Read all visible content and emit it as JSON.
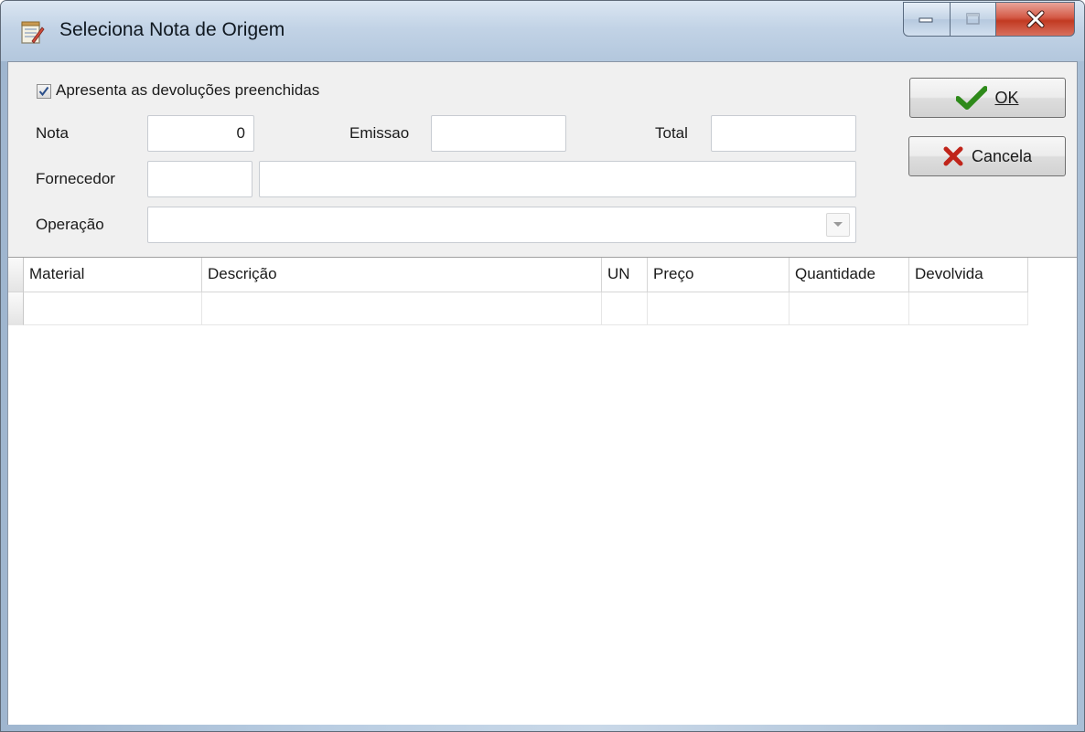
{
  "window": {
    "title": "Seleciona Nota de Origem"
  },
  "options": {
    "show_returns_label": "Apresenta as devoluções preenchidas",
    "show_returns_checked": true
  },
  "form": {
    "nota_label": "Nota",
    "nota_value": "0",
    "emissao_label": "Emissao",
    "emissao_value": "",
    "total_label": "Total",
    "total_value": "",
    "fornecedor_label": "Fornecedor",
    "fornecedor_code": "",
    "fornecedor_name": "",
    "operacao_label": "Operação",
    "operacao_value": ""
  },
  "buttons": {
    "ok_label": "OK",
    "cancel_label": "Cancela"
  },
  "grid": {
    "columns": [
      "Material",
      "Descrição",
      "UN",
      "Preço",
      "Quantidade",
      "Devolvida"
    ],
    "rows": [
      [
        "",
        "",
        "",
        "",
        "",
        ""
      ]
    ]
  },
  "colors": {
    "ok_check": "#2e8a1a",
    "cancel_x": "#c0241a"
  },
  "icons": {
    "app": "notepad-icon",
    "ok": "checkmark-icon",
    "cancel": "x-icon"
  }
}
